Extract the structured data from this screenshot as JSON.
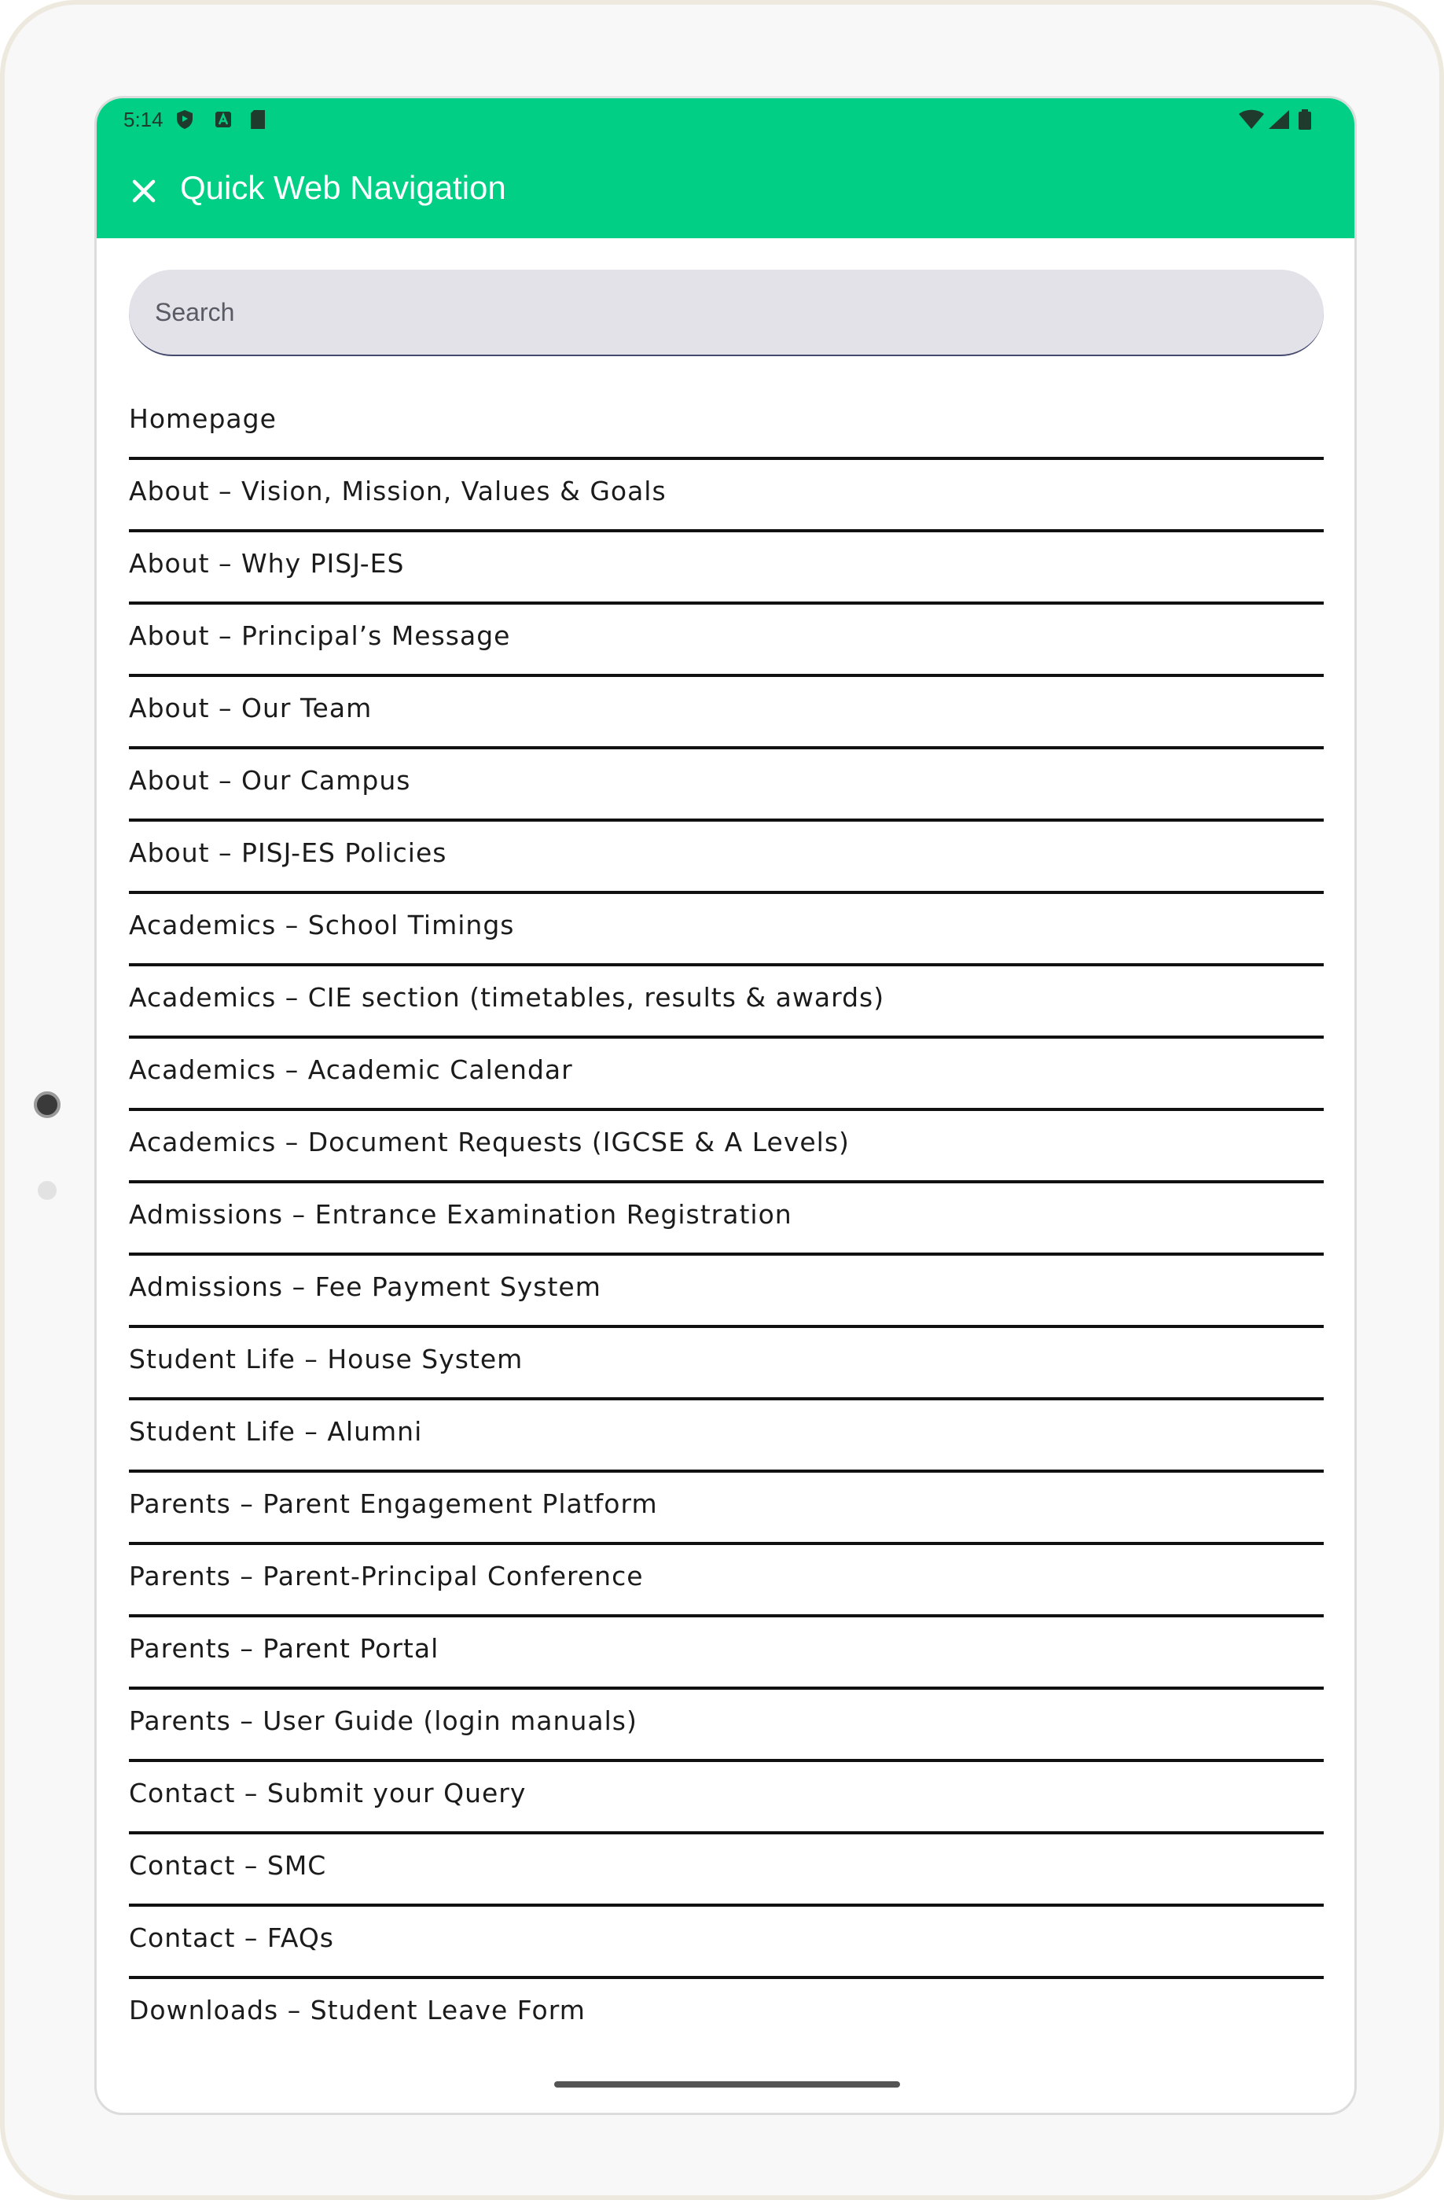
{
  "status_bar": {
    "time": "5:14"
  },
  "app_bar": {
    "title": "Quick Web Navigation",
    "close_icon": "close-icon"
  },
  "search": {
    "placeholder": "Search"
  },
  "nav_items": [
    "Homepage",
    "About – Vision, Mission, Values & Goals",
    "About – Why PISJ-ES",
    "About – Principal’s Message",
    "About – Our Team",
    "About – Our Campus",
    "About – PISJ-ES Policies",
    "Academics – School Timings",
    "Academics – CIE section (timetables, results & awards)",
    "Academics – Academic Calendar",
    "Academics – Document Requests (IGCSE & A Levels)",
    "Admissions – Entrance Examination Registration",
    "Admissions – Fee Payment System",
    "Student Life – House System",
    "Student Life – Alumni",
    "Parents – Parent Engagement Platform",
    "Parents – Parent-Principal Conference",
    "Parents – Parent Portal",
    "Parents – User Guide (login manuals)",
    "Contact – Submit your Query",
    "Contact – SMC",
    "Contact – FAQs",
    "Downloads – Student Leave Form"
  ],
  "colors": {
    "app_bar": "#00cf85",
    "search_bg": "#e3e2e9"
  }
}
